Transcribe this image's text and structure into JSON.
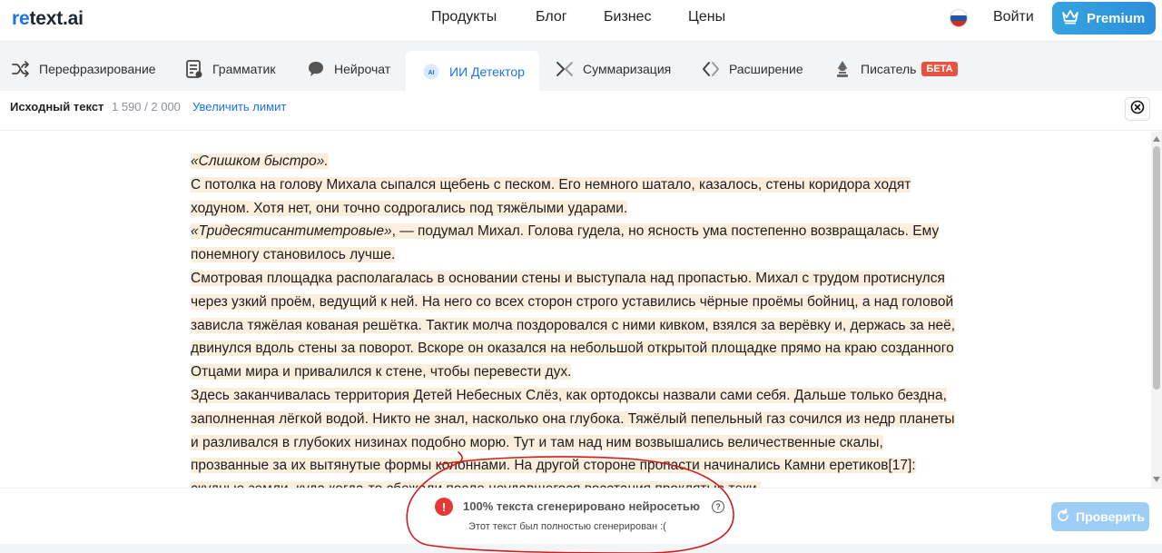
{
  "header": {
    "logo_prefix": "re",
    "logo_rest": "text.ai",
    "nav": [
      "Продукты",
      "Блог",
      "Бизнес",
      "Цены"
    ],
    "login": "Войти",
    "premium": "Premium"
  },
  "tabs": [
    {
      "label": "Перефразирование",
      "icon": "shuffle-icon"
    },
    {
      "label": "Грамматик",
      "icon": "document-check-icon"
    },
    {
      "label": "Нейрочат",
      "icon": "chat-bubble-icon"
    },
    {
      "label": "ИИ Детектор",
      "icon": "ai-badge-icon",
      "active": true
    },
    {
      "label": "Суммаризация",
      "icon": "collapse-arrows-icon"
    },
    {
      "label": "Расширение",
      "icon": "code-brackets-icon"
    },
    {
      "label": "Писатель",
      "icon": "quill-icon",
      "badge": "БЕТА"
    }
  ],
  "toolbar": {
    "source_label": "Исходный текст",
    "counter": "1 590 / 2 000",
    "increase_limit": "Увеличить лимит"
  },
  "text": {
    "p1": "«Слишком быстро».",
    "p2": "С потолка на голову Михала сыпался щебень с песком. Его немного шатало, казалось, стены коридора ходят ходуном. Хотя нет, они точно содрогались под тяжёлыми ударами.",
    "p3_italic": "«Тридесятисантиметровые»",
    "p3_rest": ", — подумал Михал. Голова гудела, но ясность ума постепенно возвращалась. Ему понемногу становилось лучше.",
    "p4": "Смотровая площадка располагалась в основании стены и выступала над пропастью. Михал с трудом протиснулся через узкий проём, ведущий к ней. На него со всех сторон строго уставились чёрные проёмы бойниц, а над головой зависла тяжёлая кованая решётка. Тактик молча поздоровался с ними кивком, взялся за верёвку и, держась за неё, двинулся вдоль стены за поворот. Вскоре он оказался на небольшой открытой площадке прямо на краю созданного Отцами мира и привалился к стене, чтобы перевести дух.",
    "p5": "Здесь заканчивалась территория Детей Небесных Слёз, как ортодоксы назвали сами себя. Дальше только бездна, заполненная лёгкой водой. Никто не знал, насколько она глубока. Тяжёлый пепельный газ сочился из недр планеты и разливался в глубоких низинах подобно морю. Тут и там над ним возвышались величественные скалы, прозванные за их вытянутые формы колоннами. На другой стороне пропасти начинались Камни еретиков[17]: скудные земли, куда когда-то сбежали после неудавшегося восстания проклятые теки."
  },
  "result": {
    "title": "100% текста сгенерировано нейросетью",
    "subtitle": "Этот текст был полностью сгенерирован :(",
    "check_button": "Проверить"
  },
  "colors": {
    "accent": "#1a73e8",
    "highlight": "#fbeedd",
    "warning": "#e53935",
    "beta_badge": "#e8533f",
    "annotation": "#cc1f1f"
  }
}
